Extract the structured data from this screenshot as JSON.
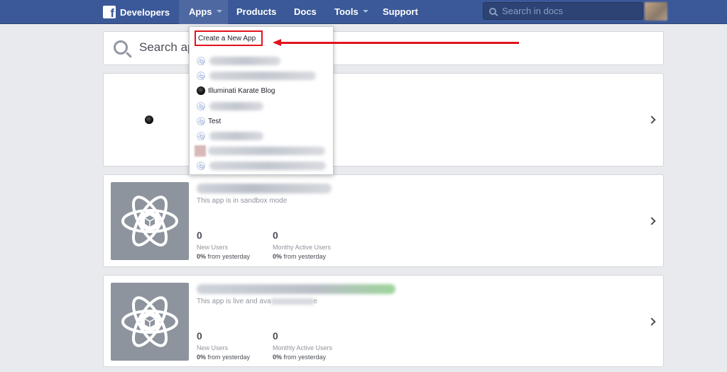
{
  "nav": {
    "brand": "Developers",
    "items": [
      {
        "label": "Apps",
        "has_caret": true
      },
      {
        "label": "Products",
        "has_caret": false
      },
      {
        "label": "Docs",
        "has_caret": false
      },
      {
        "label": "Tools",
        "has_caret": true
      },
      {
        "label": "Support",
        "has_caret": false
      }
    ],
    "search_placeholder": "Search in docs"
  },
  "main_search": {
    "placeholder": "Search ap"
  },
  "apps_dropdown": {
    "create_label": "Create a New App",
    "items": [
      {
        "label": "",
        "blurred": true,
        "icon": "atom-icon"
      },
      {
        "label": "",
        "blurred": true,
        "icon": "atom-icon"
      },
      {
        "label": "Illuminati Karate Blog",
        "blurred": false,
        "icon": "puppy-avatar-icon"
      },
      {
        "label": "",
        "blurred": true,
        "icon": "atom-icon"
      },
      {
        "label": "Test",
        "blurred": false,
        "icon": "atom-icon"
      },
      {
        "label": "",
        "blurred": true,
        "icon": "atom-icon"
      },
      {
        "label": "",
        "blurred": true,
        "icon": "photo-avatar-icon"
      },
      {
        "label": "",
        "blurred": true,
        "icon": "atom-icon"
      }
    ]
  },
  "app_cards": [
    {
      "subtitle": "This app is in sandbox mode",
      "stats": [
        {
          "value": "0",
          "label": "New Users",
          "change": "0%",
          "change_suffix": "from yesterday"
        },
        {
          "value": "0",
          "label": "Monthy Active Users",
          "change": "0%",
          "change_suffix": "from yesterday"
        }
      ]
    },
    {
      "subtitle": "This app is live and ava",
      "subtitle_tail": "e",
      "stats": [
        {
          "value": "0",
          "label": "New Users",
          "change": "0%",
          "change_suffix": "from yesterday"
        },
        {
          "value": "0",
          "label": "Monthly Active Users",
          "change": "0%",
          "change_suffix": "from yesterday"
        }
      ]
    }
  ],
  "colors": {
    "nav_bg": "#3b5998",
    "highlight": "#e2131c",
    "thumb_bg": "#8d949e"
  }
}
